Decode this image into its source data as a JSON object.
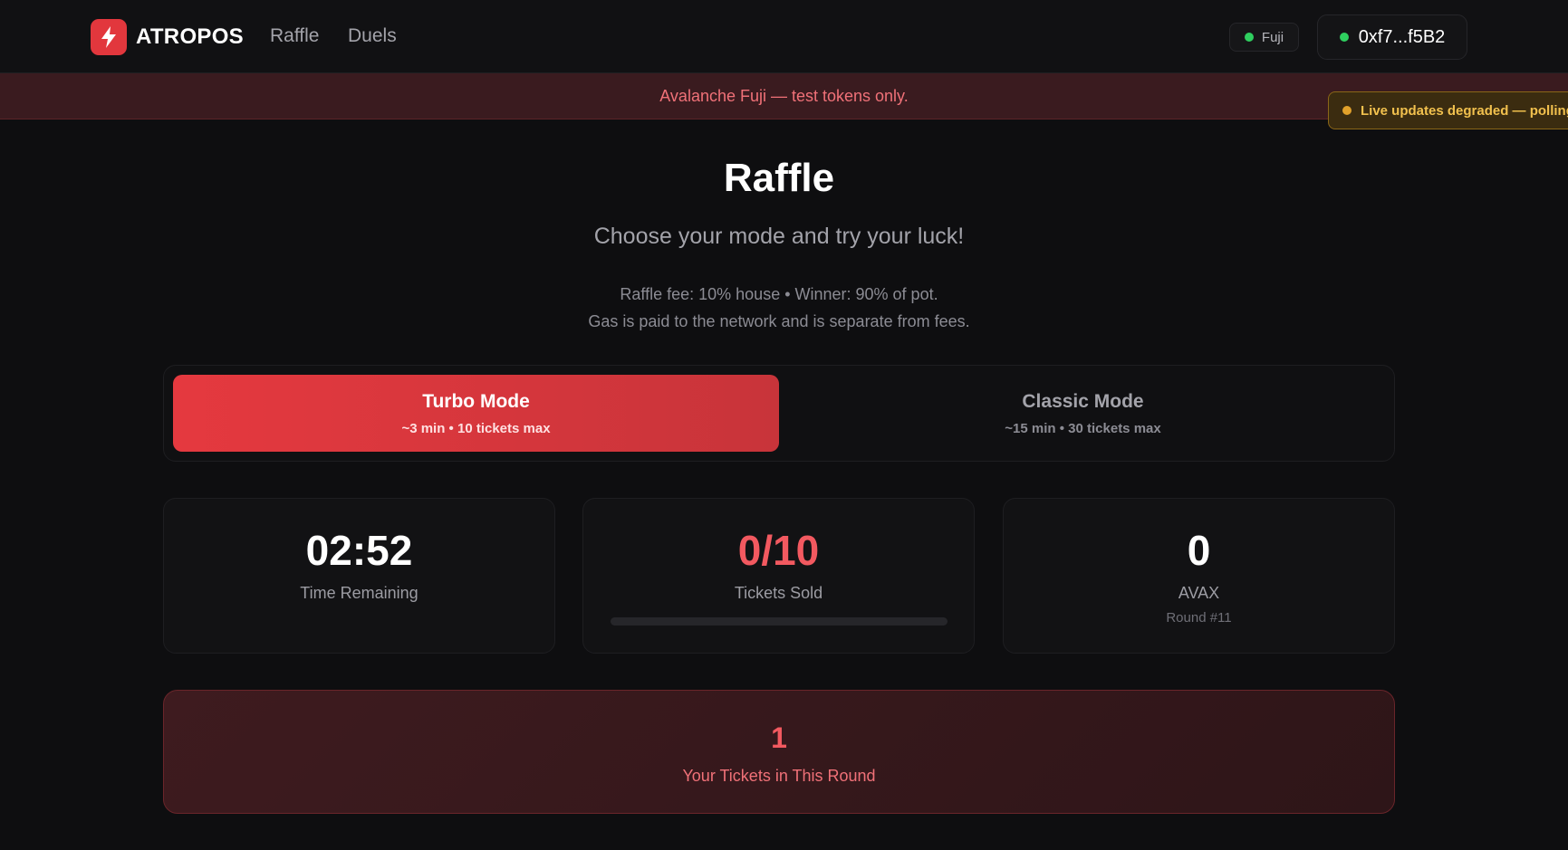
{
  "header": {
    "brand": "ATROPOS",
    "nav": [
      "Raffle",
      "Duels"
    ],
    "network_badge": "Fuji",
    "wallet_address": "0xf7...f5B2"
  },
  "banner": {
    "text": "Avalanche Fuji — test tokens only."
  },
  "toast": {
    "text": "Live updates degraded — polling"
  },
  "page": {
    "title": "Raffle",
    "subtitle": "Choose your mode and try your luck!",
    "fee_line1": "Raffle fee: 10% house • Winner: 90% of pot.",
    "fee_line2": "Gas is paid to the network and is separate from fees."
  },
  "modes": [
    {
      "title": "Turbo Mode",
      "subtitle": "~3 min • 10 tickets max",
      "active": true
    },
    {
      "title": "Classic Mode",
      "subtitle": "~15 min • 30 tickets max",
      "active": false
    }
  ],
  "stats": {
    "time": {
      "value": "02:52",
      "label": "Time Remaining"
    },
    "tickets": {
      "value": "0/10",
      "label": "Tickets Sold",
      "progress": 0
    },
    "pot": {
      "value": "0",
      "label": "AVAX",
      "round": "Round #11"
    }
  },
  "your_tickets": {
    "value": "1",
    "label": "Your Tickets in This Round"
  },
  "colors": {
    "accent": "#e5393f",
    "background": "#0e0e10",
    "online": "#2fcf5f",
    "warning": "#f2c14e"
  }
}
